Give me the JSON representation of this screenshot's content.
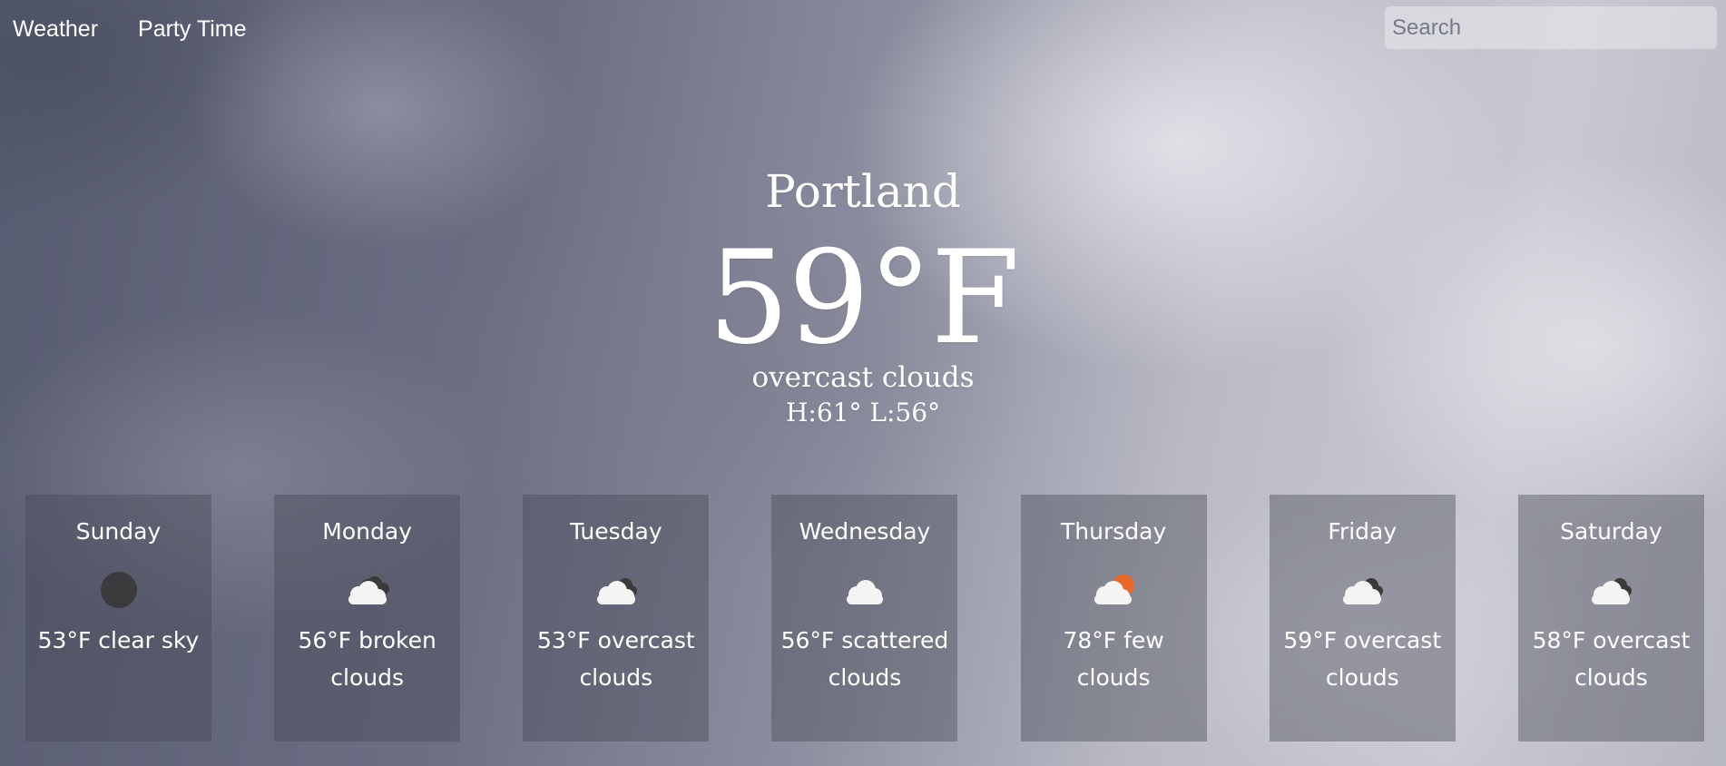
{
  "nav": {
    "items": [
      {
        "label": "Weather"
      },
      {
        "label": "Party Time"
      }
    ]
  },
  "search": {
    "placeholder": "Search",
    "value": ""
  },
  "current": {
    "city": "Portland",
    "temperature": "59°F",
    "description": "overcast clouds",
    "high_low": "H:61° L:56°"
  },
  "forecast": [
    {
      "day": "Sunday",
      "summary": "53°F clear sky",
      "icon": "clear-sky-icon"
    },
    {
      "day": "Monday",
      "summary": "56°F broken clouds",
      "icon": "broken-clouds-icon"
    },
    {
      "day": "Tuesday",
      "summary": "53°F overcast clouds",
      "icon": "overcast-clouds-icon"
    },
    {
      "day": "Wednesday",
      "summary": "56°F scattered clouds",
      "icon": "scattered-clouds-icon"
    },
    {
      "day": "Thursday",
      "summary": "78°F few clouds",
      "icon": "few-clouds-icon"
    },
    {
      "day": "Friday",
      "summary": "59°F overcast clouds",
      "icon": "overcast-clouds-icon"
    },
    {
      "day": "Saturday",
      "summary": "58°F overcast clouds",
      "icon": "overcast-clouds-icon"
    }
  ],
  "colors": {
    "sun": "#e8692a",
    "cloud": "#f4f4f4",
    "dark_cloud": "#3a3a3a",
    "night": "#3b3b3e"
  }
}
